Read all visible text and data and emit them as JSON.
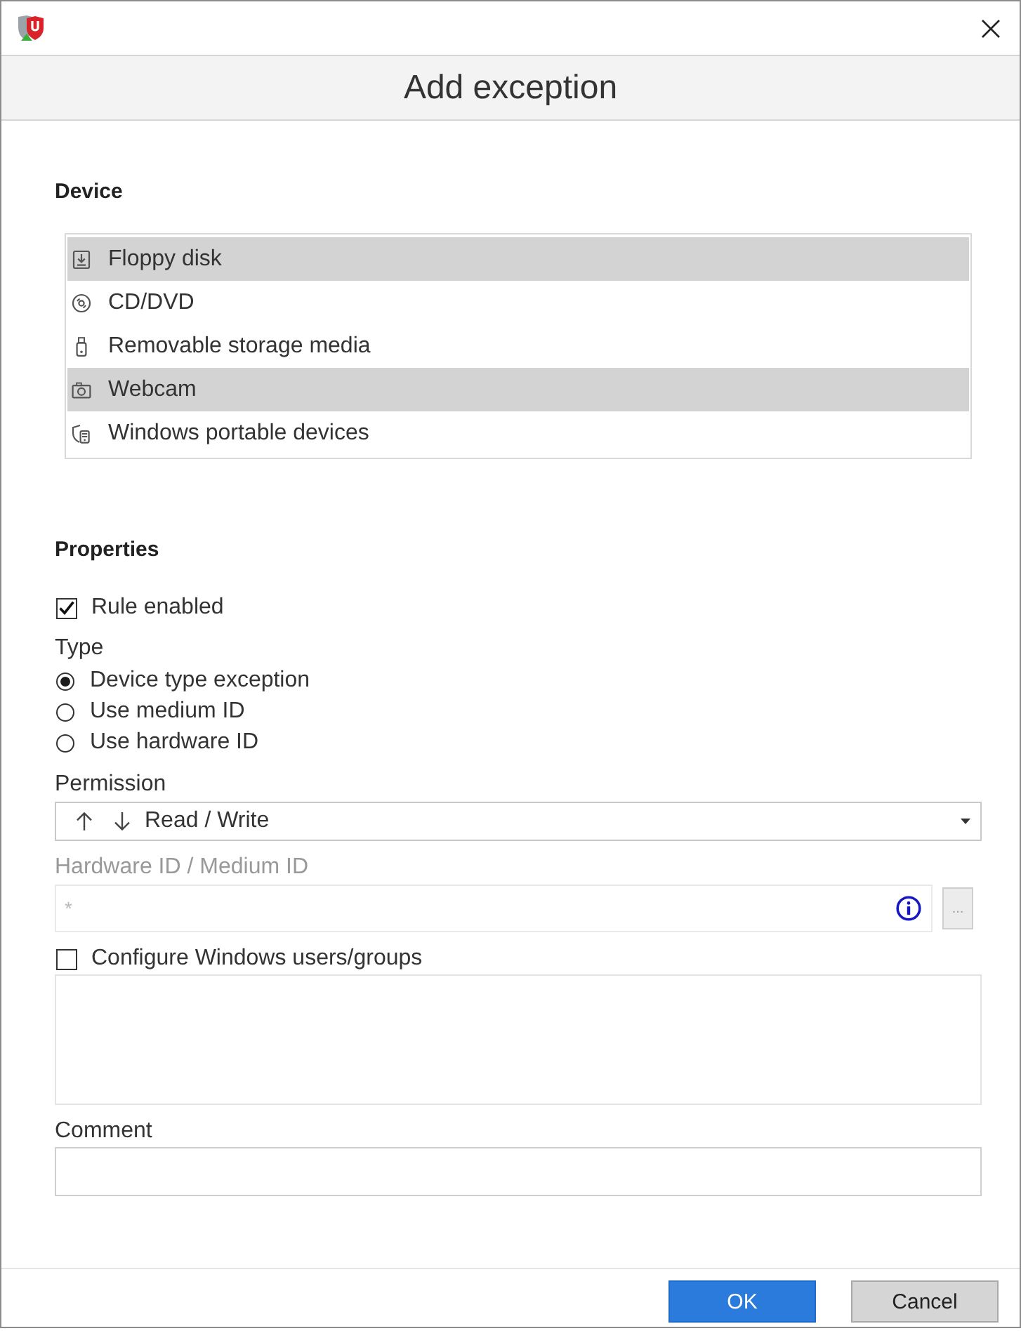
{
  "dialog": {
    "title": "Add exception"
  },
  "device": {
    "label": "Device",
    "items": [
      {
        "label": "Floppy disk",
        "kind": "floppy",
        "selected": true
      },
      {
        "label": "CD/DVD",
        "kind": "disc",
        "selected": false
      },
      {
        "label": "Removable storage media",
        "kind": "usb",
        "selected": false
      },
      {
        "label": "Webcam",
        "kind": "camera",
        "selected": true
      },
      {
        "label": "Windows portable devices",
        "kind": "portable",
        "selected": false
      }
    ]
  },
  "properties": {
    "label": "Properties",
    "rule_enabled": {
      "label": "Rule enabled",
      "checked": true
    },
    "type": {
      "label": "Type",
      "options": [
        {
          "label": "Device type exception",
          "selected": true
        },
        {
          "label": "Use medium ID",
          "selected": false
        },
        {
          "label": "Use hardware ID",
          "selected": false
        }
      ]
    },
    "permission": {
      "label": "Permission",
      "value": "Read / Write"
    },
    "hardware_id": {
      "label": "Hardware ID / Medium ID",
      "placeholder": "*",
      "disabled": true,
      "browse_button": "..."
    },
    "users_groups": {
      "label": "Configure Windows users/groups",
      "checked": false
    },
    "comment": {
      "label": "Comment"
    }
  },
  "buttons": [
    {
      "label": "OK",
      "kind": "primary"
    },
    {
      "label": "Cancel",
      "kind": "secondary"
    }
  ]
}
